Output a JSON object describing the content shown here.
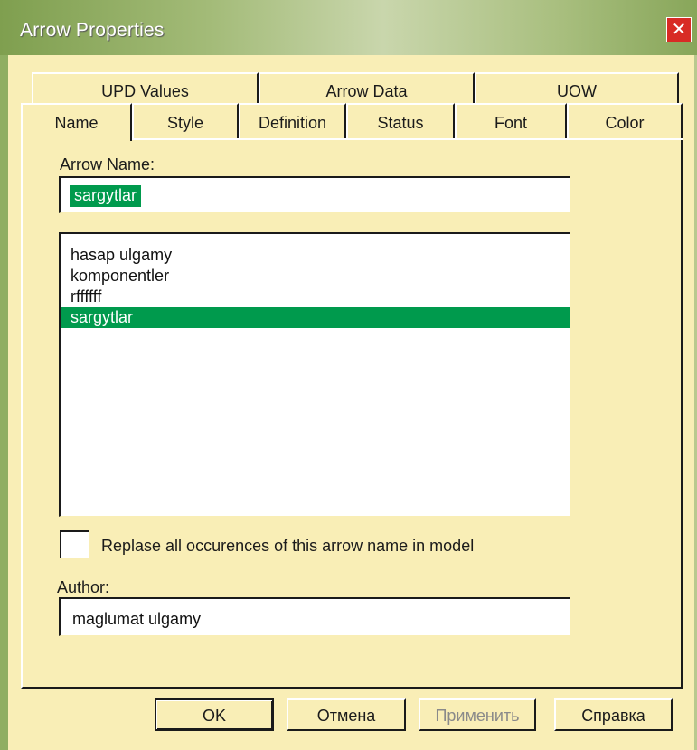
{
  "window": {
    "title": "Arrow Properties"
  },
  "tabs_row1": [
    "UPD Values",
    "Arrow Data",
    "UOW"
  ],
  "tabs_row2": [
    "Name",
    "Style",
    "Definition",
    "Status",
    "Font",
    "Color"
  ],
  "active_tab": "Name",
  "arrow_name": {
    "label": "Arrow Name:",
    "value": "sargytlar"
  },
  "names_list": {
    "items": [
      "hasap ulgamy",
      "komponentler",
      "rffffff",
      "sargytlar"
    ],
    "selected": "sargytlar"
  },
  "replace_all": {
    "label": "Replase all occurences of this arrow name in model",
    "checked": false
  },
  "author": {
    "label": "Author:",
    "value": "maglumat ulgamy"
  },
  "buttons": {
    "ok": "OK",
    "cancel": "Отмена",
    "apply": "Применить",
    "help": "Справка"
  },
  "colors": {
    "dialog_bg": "#f9eeb6",
    "selection": "#009a4d",
    "close": "#d82b25"
  }
}
